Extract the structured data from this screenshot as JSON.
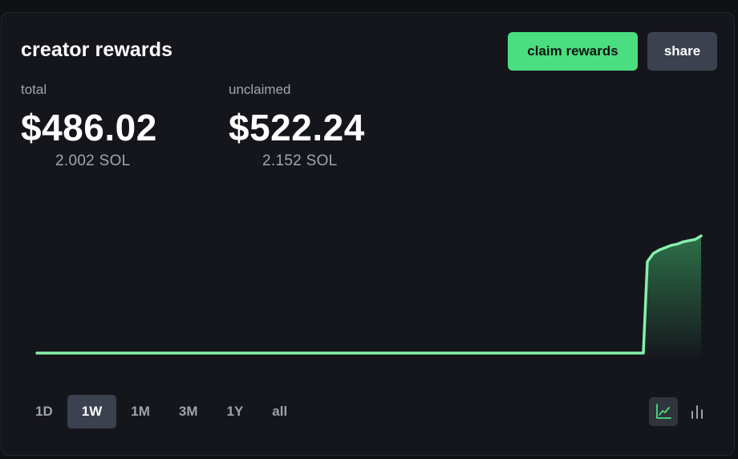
{
  "card": {
    "title": "creator rewards",
    "claim_label": "claim rewards",
    "share_label": "share"
  },
  "stats": {
    "total": {
      "label": "total",
      "usd": "$486.02",
      "sol": "2.002 SOL"
    },
    "unclaimed": {
      "label": "unclaimed",
      "usd": "$522.24",
      "sol": "2.152 SOL"
    }
  },
  "colors": {
    "accent": "#4ade80",
    "line": "#86efac",
    "button_dark": "#3b414f",
    "card_bg": "#15161c",
    "muted_text": "#a1a5ae"
  },
  "chart_data": {
    "type": "area",
    "series": [
      {
        "values": [
          0,
          0,
          0,
          0,
          0,
          0,
          0,
          0,
          0,
          0,
          0,
          0,
          0,
          0,
          0,
          0,
          0,
          0,
          0,
          0,
          0,
          0,
          0,
          0,
          0,
          0,
          0,
          0,
          0,
          0,
          0.78,
          0.85,
          0.88,
          0.9,
          0.92,
          0.93,
          0.95,
          0.96,
          0.97,
          1.0
        ]
      }
    ],
    "grid": false,
    "legend": "none"
  },
  "ranges": [
    {
      "label": "1D",
      "active": false
    },
    {
      "label": "1W",
      "active": true
    },
    {
      "label": "1M",
      "active": false
    },
    {
      "label": "3M",
      "active": false
    },
    {
      "label": "1Y",
      "active": false
    },
    {
      "label": "all",
      "active": false
    }
  ],
  "view_toggles": [
    {
      "icon": "line-chart-icon",
      "active": true
    },
    {
      "icon": "bar-chart-icon",
      "active": false
    }
  ]
}
